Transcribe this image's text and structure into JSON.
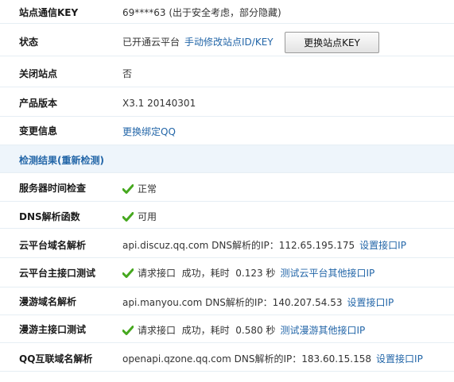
{
  "rows": {
    "key": {
      "label": "站点通信KEY",
      "value": "69****63 (出于安全考虑，部分隐藏)"
    },
    "status": {
      "label": "状态",
      "value": "已开通云平台",
      "link": "手动修改站点ID/KEY",
      "button": "更换站点KEY"
    },
    "close_site": {
      "label": "关闭站点",
      "value": "否"
    },
    "version": {
      "label": "产品版本",
      "value": "X3.1 20140301"
    },
    "change_info": {
      "label": "变更信息",
      "link": "更换绑定QQ"
    }
  },
  "section": {
    "title": "检测结果(重新检测)"
  },
  "checks": {
    "server_time": {
      "label": "服务器时间检查",
      "value": "正常"
    },
    "dns_func": {
      "label": "DNS解析函数",
      "value": "可用"
    },
    "cloud_domain": {
      "label": "云平台域名解析",
      "value": "api.discuz.qq.com DNS解析的IP：112.65.195.175",
      "link": "设置接口IP"
    },
    "cloud_api": {
      "label": "云平台主接口测试",
      "value": "请求接口  成功，耗时  0.123 秒",
      "link": "测试云平台其他接口IP"
    },
    "manyou_domain": {
      "label": "漫游域名解析",
      "value": "api.manyou.com DNS解析的IP：140.207.54.53",
      "link": "设置接口IP"
    },
    "manyou_api": {
      "label": "漫游主接口测试",
      "value": "请求接口  成功，耗时  0.580 秒",
      "link": "测试漫游其他接口IP"
    },
    "qq_domain": {
      "label": "QQ互联域名解析",
      "value": "openapi.qzone.qq.com DNS解析的IP：183.60.15.158",
      "link": "设置接口IP"
    }
  },
  "colors": {
    "link": "#2366a8",
    "check": "#46a81f",
    "section_bg": "#eef5fb",
    "row_border": "#e6eef4"
  },
  "icons": {
    "ok": "checkmark-icon"
  }
}
